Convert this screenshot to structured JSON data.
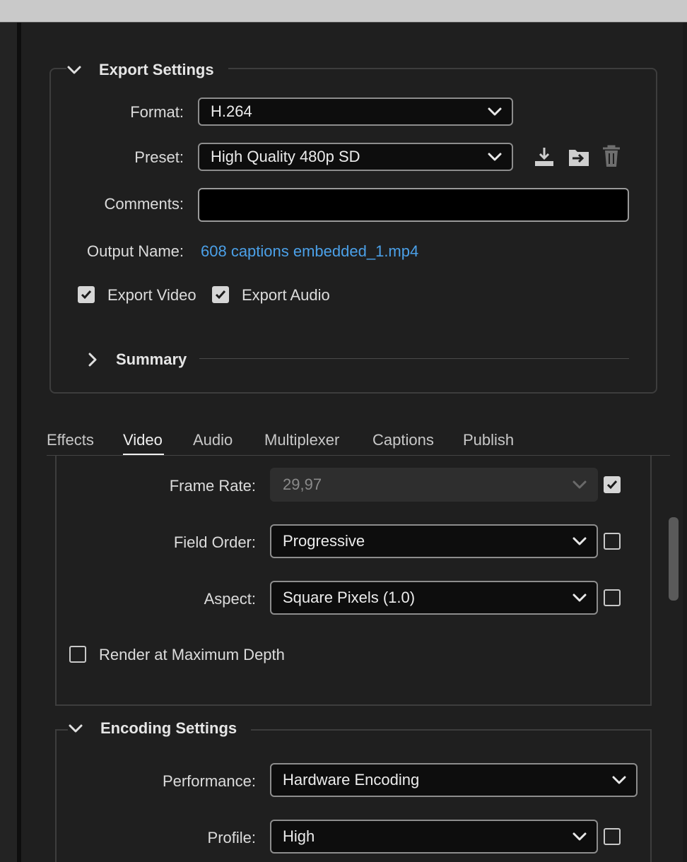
{
  "export_settings": {
    "title": "Export Settings",
    "format": {
      "label": "Format:",
      "value": "H.264"
    },
    "preset": {
      "label": "Preset:",
      "value": "High Quality 480p SD"
    },
    "comments": {
      "label": "Comments:",
      "value": ""
    },
    "output_name": {
      "label": "Output Name:",
      "value": "608 captions embedded_1.mp4"
    },
    "export_video": {
      "label": "Export Video",
      "checked": true
    },
    "export_audio": {
      "label": "Export Audio",
      "checked": true
    },
    "summary": {
      "label": "Summary"
    },
    "preset_icons": [
      "save-preset-icon",
      "import-preset-icon",
      "delete-preset-icon"
    ]
  },
  "tabs": [
    {
      "label": "Effects",
      "active": false
    },
    {
      "label": "Video",
      "active": true
    },
    {
      "label": "Audio",
      "active": false
    },
    {
      "label": "Multiplexer",
      "active": false
    },
    {
      "label": "Captions",
      "active": false
    },
    {
      "label": "Publish",
      "active": false
    }
  ],
  "video": {
    "frame_rate": {
      "label": "Frame Rate:",
      "value": "29,97",
      "disabled": true,
      "override_checked": true
    },
    "field_order": {
      "label": "Field Order:",
      "value": "Progressive",
      "override_checked": false
    },
    "aspect": {
      "label": "Aspect:",
      "value": "Square Pixels (1.0)",
      "override_checked": false
    },
    "render_max_depth": {
      "label": "Render at Maximum Depth",
      "checked": false
    }
  },
  "encoding": {
    "title": "Encoding Settings",
    "performance": {
      "label": "Performance:",
      "value": "Hardware Encoding"
    },
    "profile": {
      "label": "Profile:",
      "value": "High",
      "override_checked": false
    }
  },
  "colors": {
    "link": "#4ba0e8",
    "background": "#1f1f1f",
    "field_background": "#0d0d0d"
  }
}
